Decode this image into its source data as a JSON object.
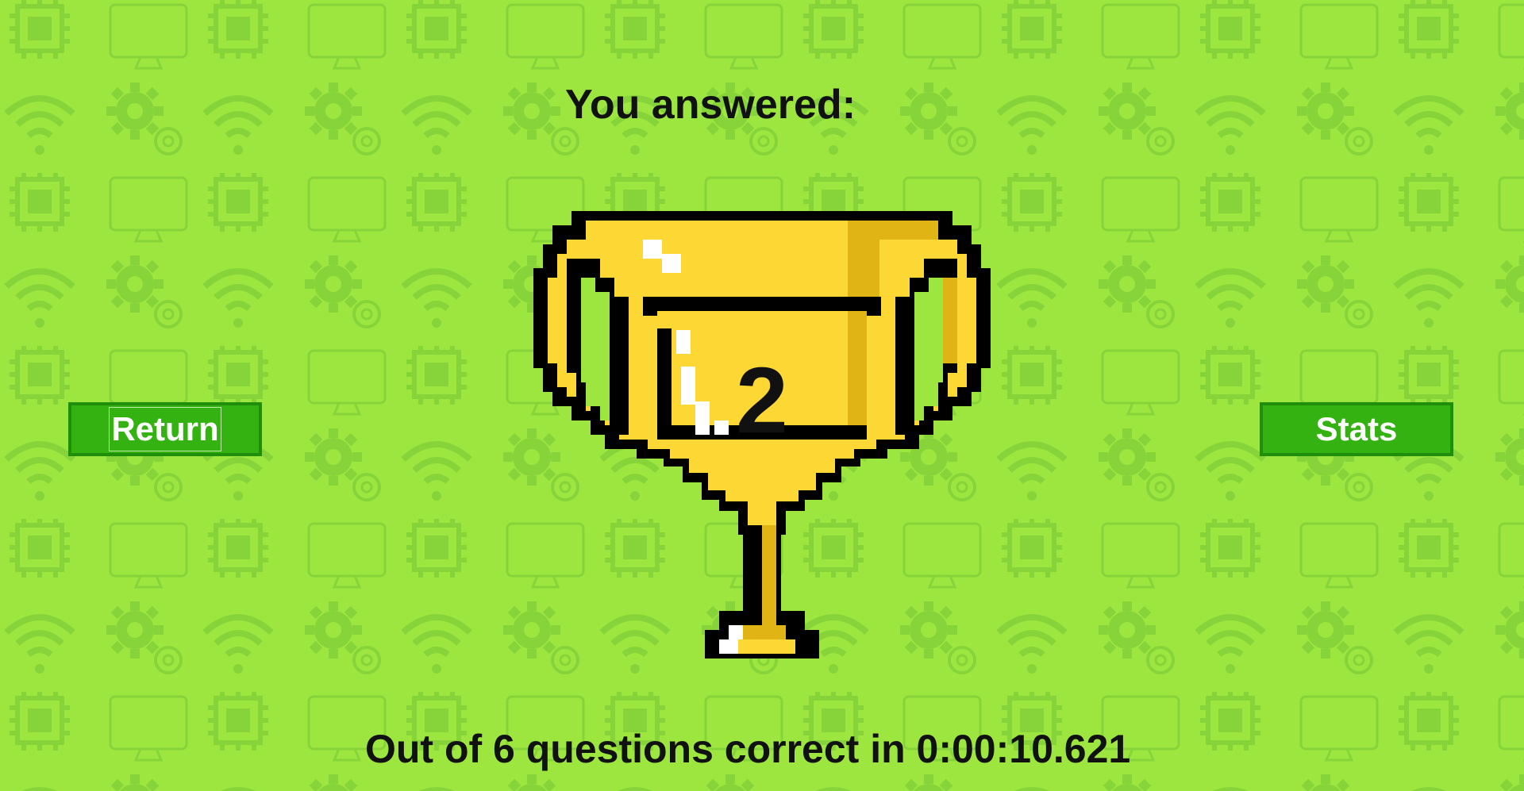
{
  "header": {
    "title": "You answered:"
  },
  "result": {
    "score": "2",
    "summary": "Out of 6 questions correct in 0:00:10.621"
  },
  "buttons": {
    "return_label": "Return",
    "stats_label": "Stats"
  },
  "colors": {
    "background": "#9ce63f",
    "pattern": "#86d43a",
    "button_fill": "#33b212",
    "button_border": "#1f8f0b",
    "trophy_gold": "#fdd835",
    "trophy_shadow": "#e0b415",
    "trophy_outline": "#000000"
  },
  "icons": {
    "background_pattern": [
      "chip-icon",
      "monitor-icon",
      "wifi-icon",
      "gear-icon"
    ],
    "trophy": "trophy-icon"
  }
}
